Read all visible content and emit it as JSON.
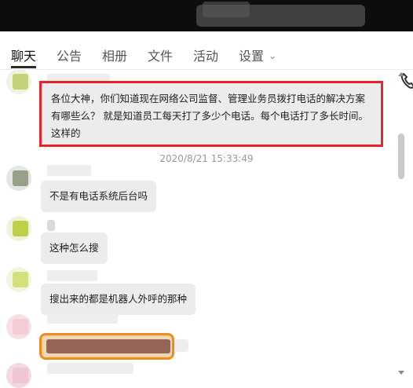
{
  "tabs": [
    {
      "label": "聊天",
      "active": true
    },
    {
      "label": "公告"
    },
    {
      "label": "相册"
    },
    {
      "label": "文件"
    },
    {
      "label": "活动"
    },
    {
      "label": "设置"
    }
  ],
  "settings_caret": "⌄",
  "messages": {
    "highlighted": "各位大神，你们知道现在网络公司监督、管理业务员拨打电话的解决方案有哪些么？ 就是知道员工每天打了多少个电话。每个电话打了多长时间。这样的",
    "timestamp": "2020/8/21 15:33:49",
    "m1": "不是有电话系统后台吗",
    "m2": "这种怎么搜",
    "m3": "搜出来的都是机器人外呼的那种"
  },
  "colors": {
    "highlight_border": "#e8232a",
    "orange_border": "#f08c1e",
    "bubble_bg": "#ececec"
  },
  "icons": {
    "phone": "phone-icon",
    "caret": "chevron-down-icon"
  }
}
